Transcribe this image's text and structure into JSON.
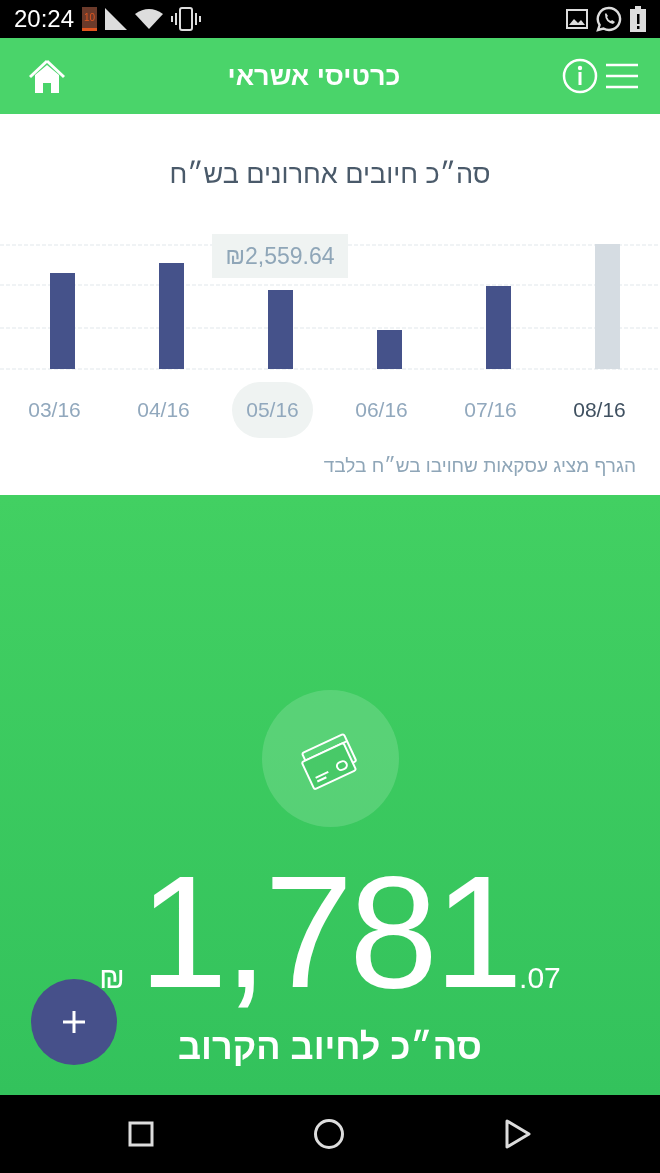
{
  "status_bar": {
    "time": "20:24",
    "battery_saver_level": "10"
  },
  "header": {
    "title": "כרטיסי אשראי"
  },
  "chart": {
    "title": "סה״כ חיובים אחרונים בש״ח",
    "tooltip": "₪2,559.64",
    "note": "הגרף מציג עסקאות שחויבו בש״ח בלבד",
    "months": [
      {
        "label": "03/16",
        "selected": false,
        "current": false
      },
      {
        "label": "04/16",
        "selected": false,
        "current": false
      },
      {
        "label": "05/16",
        "selected": true,
        "current": false
      },
      {
        "label": "06/16",
        "selected": false,
        "current": false
      },
      {
        "label": "07/16",
        "selected": false,
        "current": false
      },
      {
        "label": "08/16",
        "selected": false,
        "current": true
      }
    ]
  },
  "summary": {
    "currency": "₪",
    "amount": "1,781",
    "cents": ".07",
    "label": "סה״כ לחיוב הקרוב"
  }
}
